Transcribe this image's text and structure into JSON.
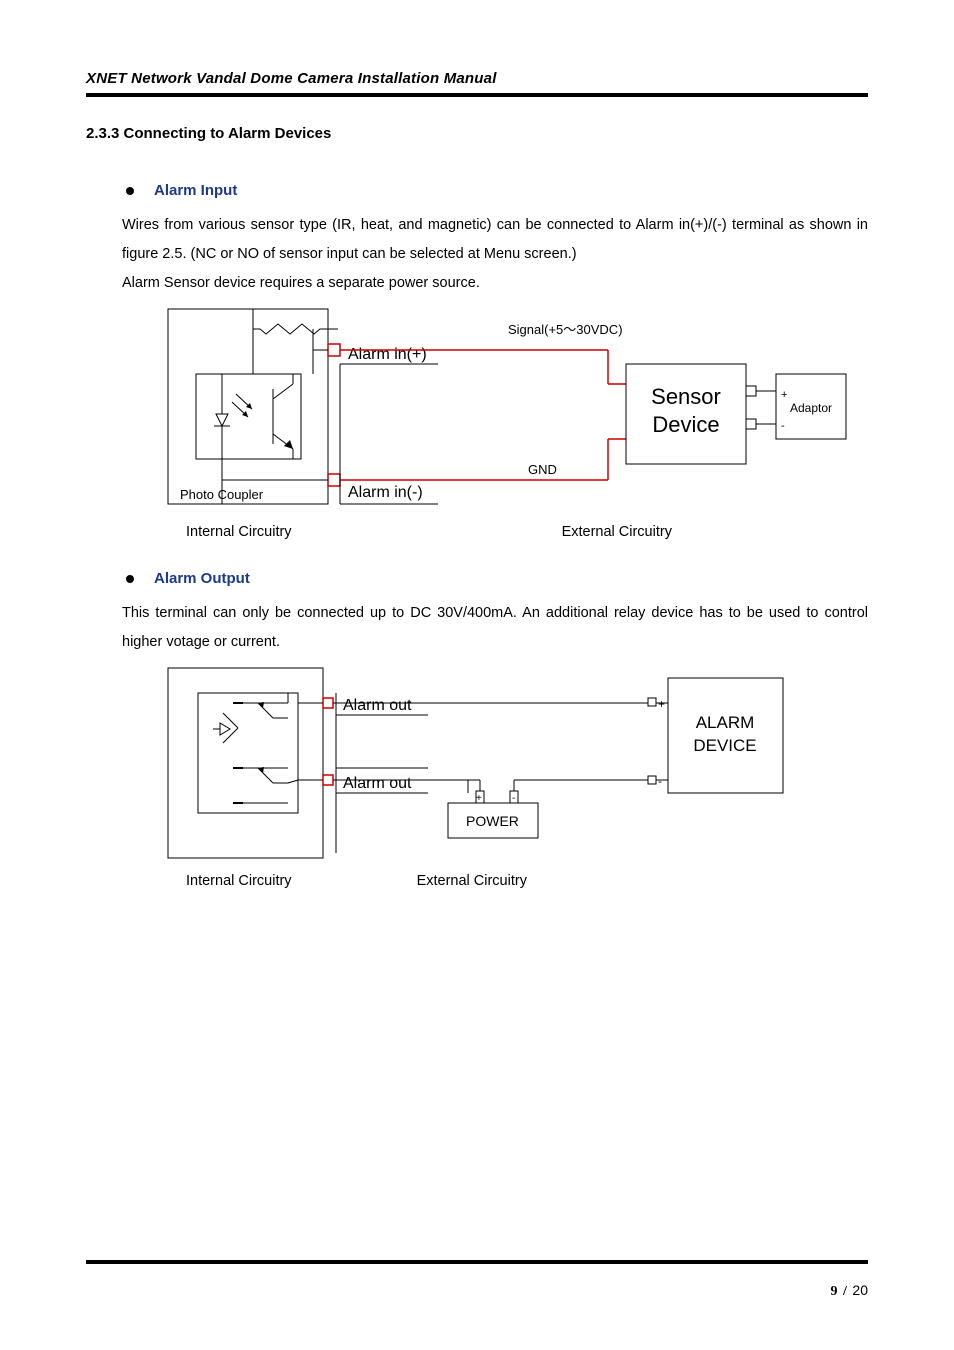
{
  "header": {
    "title": "XNET Network Vandal Dome Camera Installation Manual"
  },
  "section": {
    "heading": "2.3.3 Connecting to Alarm Devices"
  },
  "alarm_input": {
    "title": "Alarm Input",
    "para": "Wires from various sensor type (IR, heat, and magnetic) can be connected to Alarm in(+)/(-) terminal as shown in figure 2.5. (NC or NO of sensor input can be selected at Menu screen.)",
    "para2": "Alarm Sensor device requires a separate power source.",
    "diagram": {
      "photo_coupler": "Photo Coupler",
      "alarm_in_plus": "Alarm in(+)",
      "alarm_in_minus": "Alarm in(-)",
      "signal_label": "Signal(+5～30VDC)",
      "gnd": "GND",
      "sensor": "Sensor Device",
      "adaptor": "Adaptor",
      "plus": "+",
      "minus": "-"
    },
    "caption_left": "Internal Circuitry",
    "caption_right": "External Circuitry"
  },
  "alarm_output": {
    "title": "Alarm Output",
    "para": "This terminal can only be connected up to DC 30V/400mA.   An additional relay device has to be used to control higher votage or current.",
    "diagram": {
      "alarm_out": "Alarm out",
      "power": "POWER",
      "alarm_device": "ALARM DEVICE",
      "plus": "+",
      "minus": "-"
    },
    "caption_left": "Internal Circuitry",
    "caption_right": "External Circuitry"
  },
  "footer": {
    "page_current": "9",
    "page_sep": " / ",
    "page_total": "20"
  }
}
